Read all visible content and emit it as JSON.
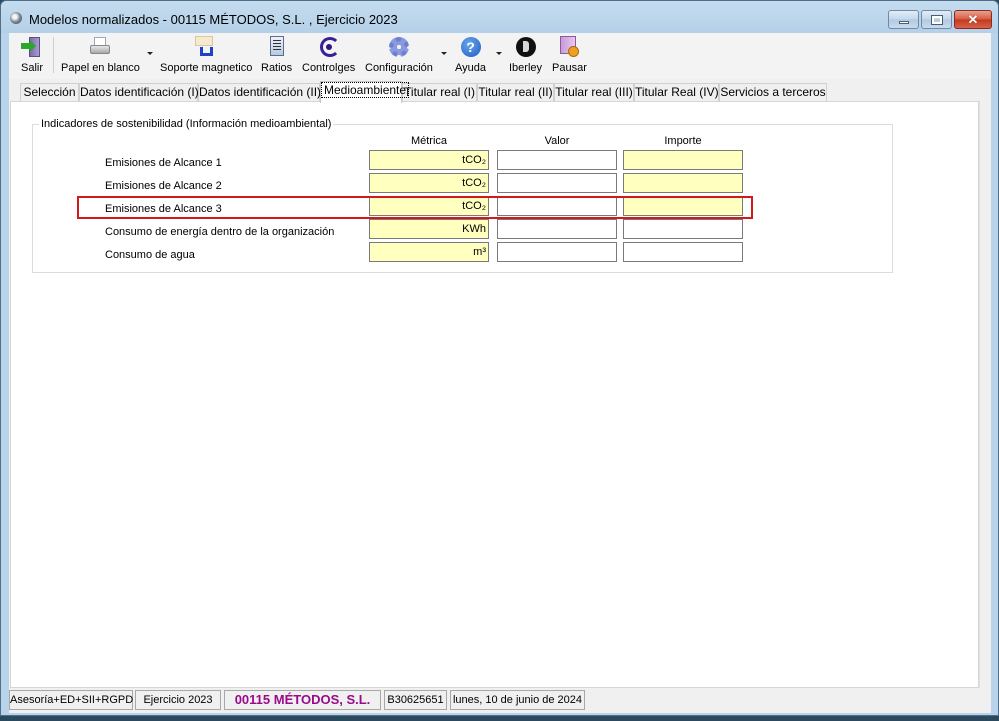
{
  "window": {
    "title": "Modelos normalizados - 00115 MÉTODOS, S.L. , Ejercicio 2023",
    "controls": {
      "minimize": "—",
      "maximize": "□",
      "close": "✕"
    }
  },
  "toolbar": {
    "buttons": [
      {
        "label": "Salir",
        "icon": "exit-door-icon"
      },
      {
        "label": "Papel en blanco",
        "icon": "printer-icon",
        "dropdown": true
      },
      {
        "label": "Soporte magnetico",
        "icon": "floppy-disk-icon"
      },
      {
        "label": "Ratios",
        "icon": "document-icon"
      },
      {
        "label": "Controlges",
        "icon": "eye-logo-icon"
      },
      {
        "label": "Configuración",
        "icon": "gear-icon",
        "dropdown": true
      },
      {
        "label": "Ayuda",
        "icon": "help-icon",
        "dropdown": true
      },
      {
        "label": "Iberley",
        "icon": "iberley-logo-icon"
      },
      {
        "label": "Pausar",
        "icon": "pause-book-icon"
      }
    ],
    "help_glyph": "?"
  },
  "tabs": [
    {
      "label": "Selección",
      "active": false
    },
    {
      "label": "Datos identificación (I)",
      "active": false
    },
    {
      "label": "Datos identificación (II)",
      "active": false
    },
    {
      "label": "Medioambiente",
      "active": true
    },
    {
      "label": "Titular real (I)",
      "active": false
    },
    {
      "label": "Titular real (II)",
      "active": false
    },
    {
      "label": "Titular real (III)",
      "active": false
    },
    {
      "label": "Titular Real (IV)",
      "active": false
    },
    {
      "label": "Servicios a terceros",
      "active": false
    }
  ],
  "sustainability": {
    "group_title": "Indicadores de sostenibilidad (Información medioambiental)",
    "columns": {
      "metric": "Métrica",
      "valor": "Valor",
      "importe": "Importe"
    },
    "rows": [
      {
        "label": "Emisiones de Alcance 1",
        "metric": "tCO₂",
        "valor": "",
        "importe": "",
        "importe_color": "yellow"
      },
      {
        "label": "Emisiones de Alcance 2",
        "metric": "tCO₂",
        "valor": "",
        "importe": "",
        "importe_color": "yellow"
      },
      {
        "label": "Emisiones de Alcance 3",
        "metric": "tCO₂",
        "valor": "",
        "importe": "",
        "importe_color": "yellow",
        "highlighted": true
      },
      {
        "label": "Consumo de energía dentro de la organización",
        "metric": "KWh",
        "valor": "",
        "importe": "",
        "importe_color": "white"
      },
      {
        "label": "Consumo de agua",
        "metric": "m³",
        "valor": "",
        "importe": "",
        "importe_color": "white"
      }
    ],
    "highlight_color": "#d11a1a"
  },
  "statusbar": {
    "product": "Asesoría+ED+SII+RGPD",
    "exercise": "Ejercicio 2023",
    "company": "00115 MÉTODOS, S.L.",
    "tax_id": "B30625651",
    "date": "lunes, 10 de junio de 2024",
    "company_color": "#9a0a8a"
  },
  "colors": {
    "field_yellow": "#ffffc0",
    "titlebar": "#b9d3ea"
  }
}
